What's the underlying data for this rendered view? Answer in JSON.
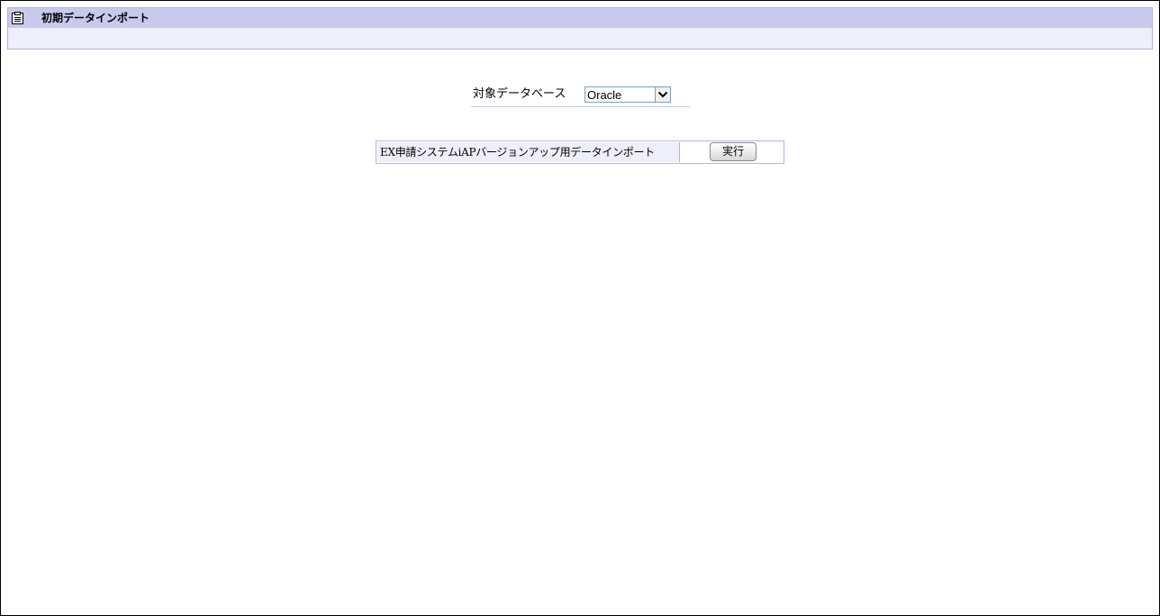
{
  "header": {
    "title": "初期データインポート",
    "icon": "clipboard-icon"
  },
  "database": {
    "label": "対象データベース",
    "selected": "Oracle"
  },
  "import": {
    "label": "EX申請システムiAPバージョンアップ用データインポート",
    "button_label": "実行"
  },
  "colors": {
    "header_bar": "#c8c9ec",
    "header_body": "#eeeffa",
    "border": "#b4b4dc"
  }
}
